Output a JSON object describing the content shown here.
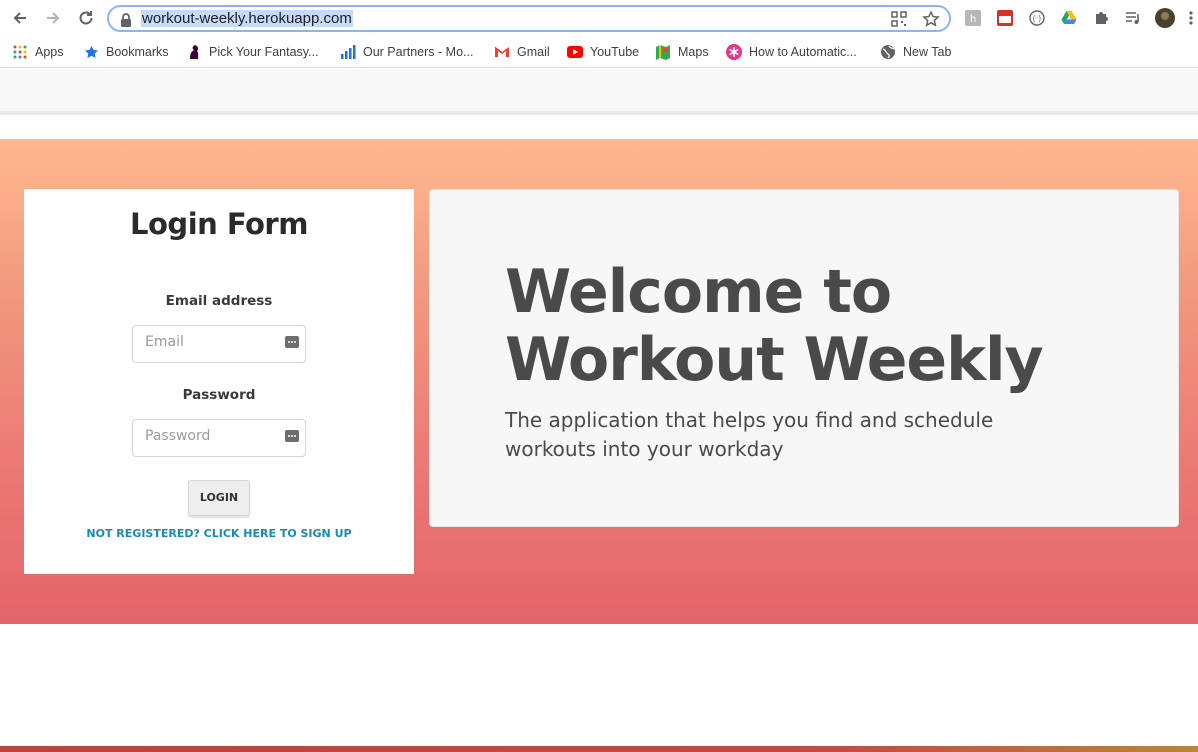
{
  "browser": {
    "url": "workout-weekly.herokuapp.com",
    "bookmarks": [
      {
        "label": "Apps",
        "icon": "apps-grid-icon"
      },
      {
        "label": "Bookmarks",
        "icon": "star-icon"
      },
      {
        "label": "Pick Your Fantasy...",
        "icon": "premier-league-icon"
      },
      {
        "label": "Our Partners - Mo...",
        "icon": "bar-chart-icon"
      },
      {
        "label": "Gmail",
        "icon": "gmail-icon"
      },
      {
        "label": "YouTube",
        "icon": "youtube-icon"
      },
      {
        "label": "Maps",
        "icon": "maps-icon"
      },
      {
        "label": "How to Automatic...",
        "icon": "asterisk-icon"
      },
      {
        "label": "New Tab",
        "icon": "globe-icon"
      }
    ]
  },
  "login": {
    "title": "Login Form",
    "email_label": "Email address",
    "email_placeholder": "Email",
    "password_label": "Password",
    "password_placeholder": "Password",
    "login_button": "LOGIN",
    "signup_link": "NOT REGISTERED? CLICK HERE TO SIGN UP"
  },
  "welcome": {
    "title": "Welcome to Workout Weekly",
    "subtitle": "The application that helps you find and schedule workouts into your workday"
  },
  "colors": {
    "hero_top": "#ffb88f",
    "hero_bottom": "#e3646a",
    "link": "#1a8bb0",
    "heading": "#4a4a4a"
  }
}
